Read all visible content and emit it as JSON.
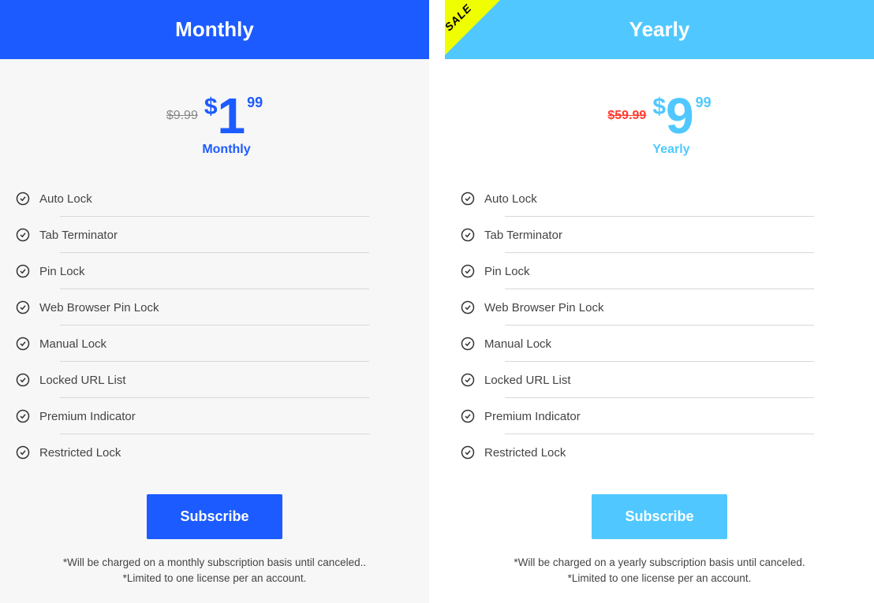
{
  "plans": [
    {
      "title": "Monthly",
      "old_price": "$9.99",
      "currency": "$",
      "amount": "1",
      "cents": "99",
      "period": "Monthly",
      "subscribe": "Subscribe",
      "note1": "*Will be charged on a monthly subscription basis until canceled..",
      "note2": "*Limited to one license per an account.",
      "sale": ""
    },
    {
      "title": "Yearly",
      "old_price": "$59.99",
      "currency": "$",
      "amount": "9",
      "cents": "99",
      "period": "Yearly",
      "subscribe": "Subscribe",
      "note1": "*Will be charged on a yearly subscription basis until canceled.",
      "note2": "*Limited to one license per an account.",
      "sale": "SALE"
    }
  ],
  "features": [
    "Auto Lock",
    "Tab Terminator",
    "Pin Lock",
    "Web Browser Pin Lock",
    "Manual Lock",
    "Locked URL List",
    "Premium Indicator",
    "Restricted Lock"
  ]
}
